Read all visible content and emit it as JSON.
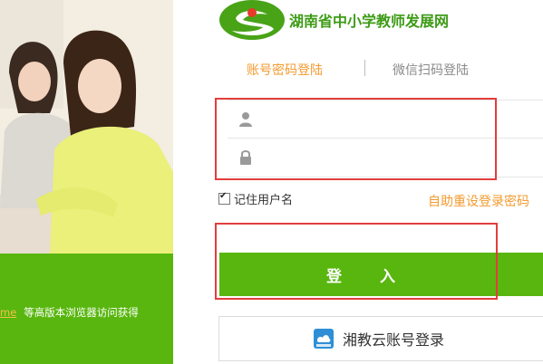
{
  "site": {
    "title": "湖南省中小学教师发展网"
  },
  "tabs": {
    "password_login": "账号密码登陆",
    "wechat_login": "微信扫码登陆"
  },
  "form": {
    "username_placeholder": "",
    "password_placeholder": "",
    "remember_label": "记住用户名",
    "reset_link": "自助重设登录密码",
    "login_button": "登 入",
    "xjy_login": "湘教云账号登录"
  },
  "left_panel": {
    "browser_link": "me",
    "browser_note": "等高版本浏览器访问获得"
  },
  "colors": {
    "brand_green": "#58b60e",
    "accent_orange": "#f39a2e",
    "highlight_red": "#e33d3d"
  },
  "icons": {
    "username": "person-icon",
    "password": "lock-icon",
    "xjy": "xiangjiaoyun-logo-icon"
  }
}
